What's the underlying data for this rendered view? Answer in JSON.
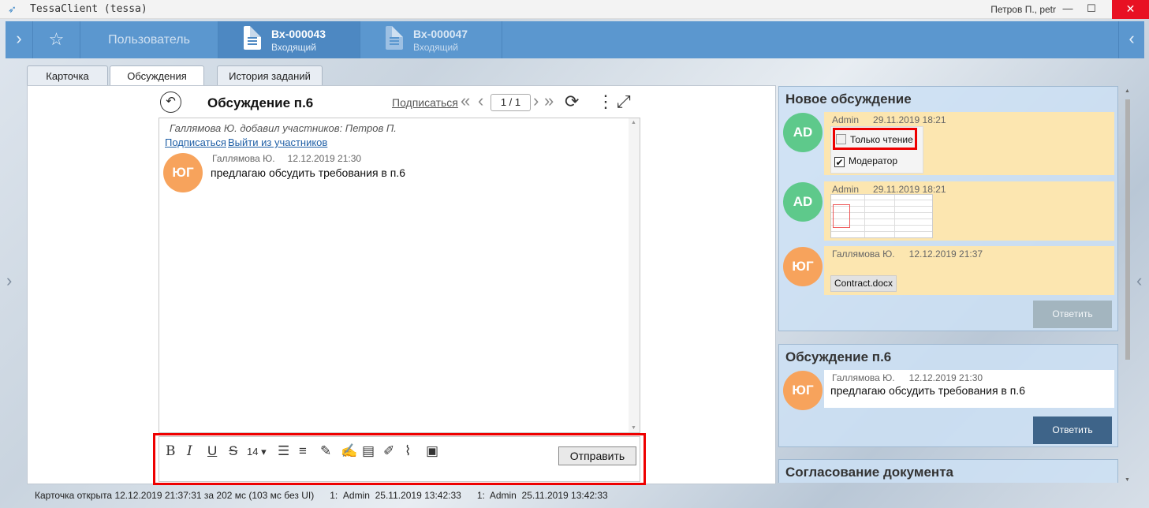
{
  "window": {
    "title": "TessaClient (tessa)",
    "user": "Петров П., petr",
    "minimize": "—",
    "maximize": "☐",
    "close": "✕"
  },
  "header": {
    "expand_icon": "›",
    "star_icon": "☆",
    "user_tab": "Пользователь",
    "tabs": [
      {
        "number": "Вх-000043",
        "type": "Входящий"
      },
      {
        "number": "Вх-000047",
        "type": "Входящий"
      }
    ],
    "collapse_icon": "‹"
  },
  "side_arrows": {
    "left": "›",
    "right": "‹"
  },
  "card_tabs": [
    {
      "label": "Карточка",
      "active": false
    },
    {
      "label": "Обсуждения",
      "active": true
    },
    {
      "label": "История заданий",
      "active": false
    }
  ],
  "discussion": {
    "back_icon": "↶",
    "title": "Обсуждение п.6",
    "subscribe": "Подписаться",
    "pager": {
      "first": "«",
      "prev": "‹",
      "value": "1 / 1",
      "next": "›",
      "last": "»"
    },
    "refresh_icon": "⟳",
    "more_icon": "⋮",
    "expand_icon": "⤢",
    "system_message": "Галлямова Ю. добавил участников: Петров П.",
    "link_subscribe": "Подписаться",
    "link_leave": "Выйти из участников",
    "messages": [
      {
        "initials": "ЮГ",
        "author": "Галлямова Ю.",
        "date": "12.12.2019 21:30",
        "text": "предлагаю обсудить требования в п.6"
      }
    ]
  },
  "editor": {
    "tools": [
      "B",
      "I",
      "U",
      "S",
      "14 ▾",
      "☰",
      "≡",
      "✎",
      "✍",
      "▤",
      "✐",
      "⌇",
      "▣"
    ],
    "tool_names": [
      "bold-icon",
      "italic-icon",
      "underline-icon",
      "strikethrough-icon",
      "font-size-select",
      "bullet-list-icon",
      "numbered-list-icon",
      "pen-icon",
      "signature-icon",
      "table-icon",
      "edit-icon",
      "attach-icon",
      "image-icon"
    ],
    "send": "Отправить"
  },
  "status": "Карточка открыта 12.12.2019 21:37:31 за 202 мс (103 мс без UI)      1:  Admin  25.11.2019 13:42:33      1:  Admin  25.11.2019 13:42:33",
  "right_panel": {
    "new_discussion": {
      "title": "Новое обсуждение",
      "messages": [
        {
          "initials": "AD",
          "author": "Admin",
          "date": "29.11.2019 18:21",
          "read_only": "Только чтение",
          "moderator": "Модератор"
        },
        {
          "initials": "AD",
          "author": "Admin",
          "date": "29.11.2019 18:21"
        },
        {
          "initials": "ЮГ",
          "author": "Галлямова Ю.",
          "date": "12.12.2019 21:37",
          "file": "Contract.docx"
        }
      ],
      "reply": "Ответить"
    },
    "discussion_p6": {
      "title": "Обсуждение п.6",
      "message": {
        "initials": "ЮГ",
        "author": "Галлямова Ю.",
        "date": "12.12.2019 21:30",
        "text": "предлагаю обсудить требования в п.6"
      },
      "reply": "Ответить"
    },
    "approval": {
      "title": "Согласование документа"
    }
  },
  "colors": {
    "header": "#5b97cf",
    "accent_red": "#e00000",
    "avatar_orange": "#f7a35c",
    "avatar_green": "#5ec98b",
    "bubble": "#fce6b0",
    "reply_active": "#3e6489"
  }
}
